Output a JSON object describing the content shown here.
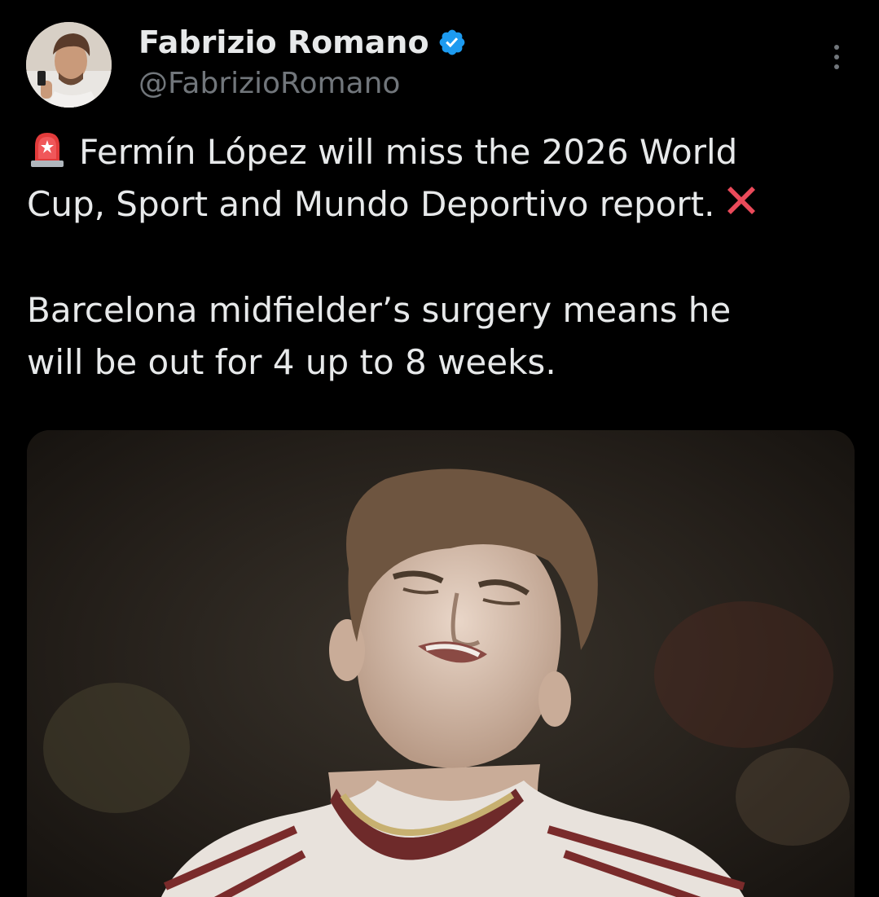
{
  "author": {
    "display_name": "Fabrizio Romano",
    "handle": "@FabrizioRomano",
    "verified": true,
    "verified_color": "#1d9bf0"
  },
  "icons": {
    "siren": "rotating-light-icon",
    "cross": "cross-mark-icon",
    "more": "more-vertical-icon",
    "verified": "verified-badge-icon"
  },
  "tweet": {
    "line1": "Fermín López will miss the 2026 World",
    "line2": "Cup, Sport and Mundo Deportivo report.",
    "line3": "Barcelona midfielder’s surgery means he",
    "line4": "will be out for 4 up to 8 weeks."
  },
  "colors": {
    "background": "#000000",
    "text": "#e7e9ea",
    "secondary": "#71767b"
  }
}
